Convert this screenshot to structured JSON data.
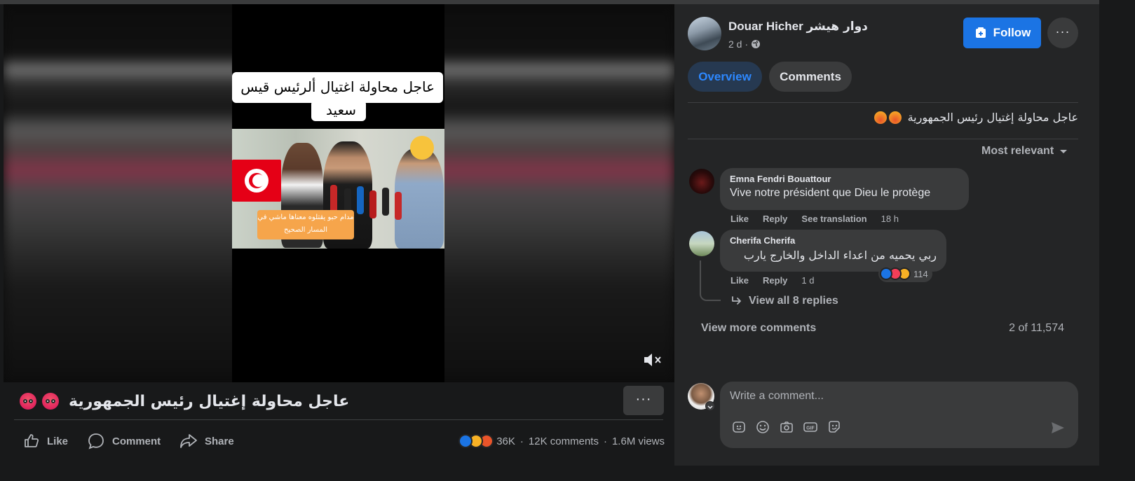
{
  "video": {
    "caption_line1": "عاجل محاولة اغتيال ألرئيس قيس",
    "caption_line2": "سعيد",
    "overlay_caption_line1": "مدام حبو يقتلوه معناها ماشي في",
    "overlay_caption_line2": "المسار الصحيح",
    "mute_icon": "muted-speaker-icon"
  },
  "post": {
    "title": "عاجل محاولة إغتيال رئيس الجمهورية",
    "more_label": "···",
    "actions": {
      "like": "Like",
      "comment": "Comment",
      "share": "Share"
    },
    "stats": {
      "reactions": "36K",
      "comments": "12K comments",
      "views": "1.6M views",
      "separator": "·"
    }
  },
  "page": {
    "name_latin": "Douar Hicher",
    "name_arabic": "دوار هيشر",
    "time": "2 d",
    "time_separator": "·",
    "follow_label": "Follow",
    "more_label": "···"
  },
  "tabs": {
    "overview": "Overview",
    "comments": "Comments"
  },
  "post_text": "عاجل محاولة إغتيال رئيس الجمهورية",
  "sort_label": "Most relevant",
  "comments": [
    {
      "author": "Emna Fendri Bouattour",
      "text": "Vive notre président que Dieu le protège",
      "like": "Like",
      "reply": "Reply",
      "translate": "See translation",
      "time": "18 h"
    },
    {
      "author": "Cherifa Cherifa",
      "text": "ربي يحميه من اعداء الداخل والخارج يارب",
      "like": "Like",
      "reply": "Reply",
      "time": "1 d",
      "reaction_count": "114",
      "view_replies": "View all 8 replies"
    }
  ],
  "view_more_comments": "View more comments",
  "comment_count": "2 of 11,574",
  "composer": {
    "placeholder": "Write a comment..."
  },
  "colors": {
    "accent": "#1b74e4",
    "panel": "#242526",
    "background": "#18191a"
  }
}
